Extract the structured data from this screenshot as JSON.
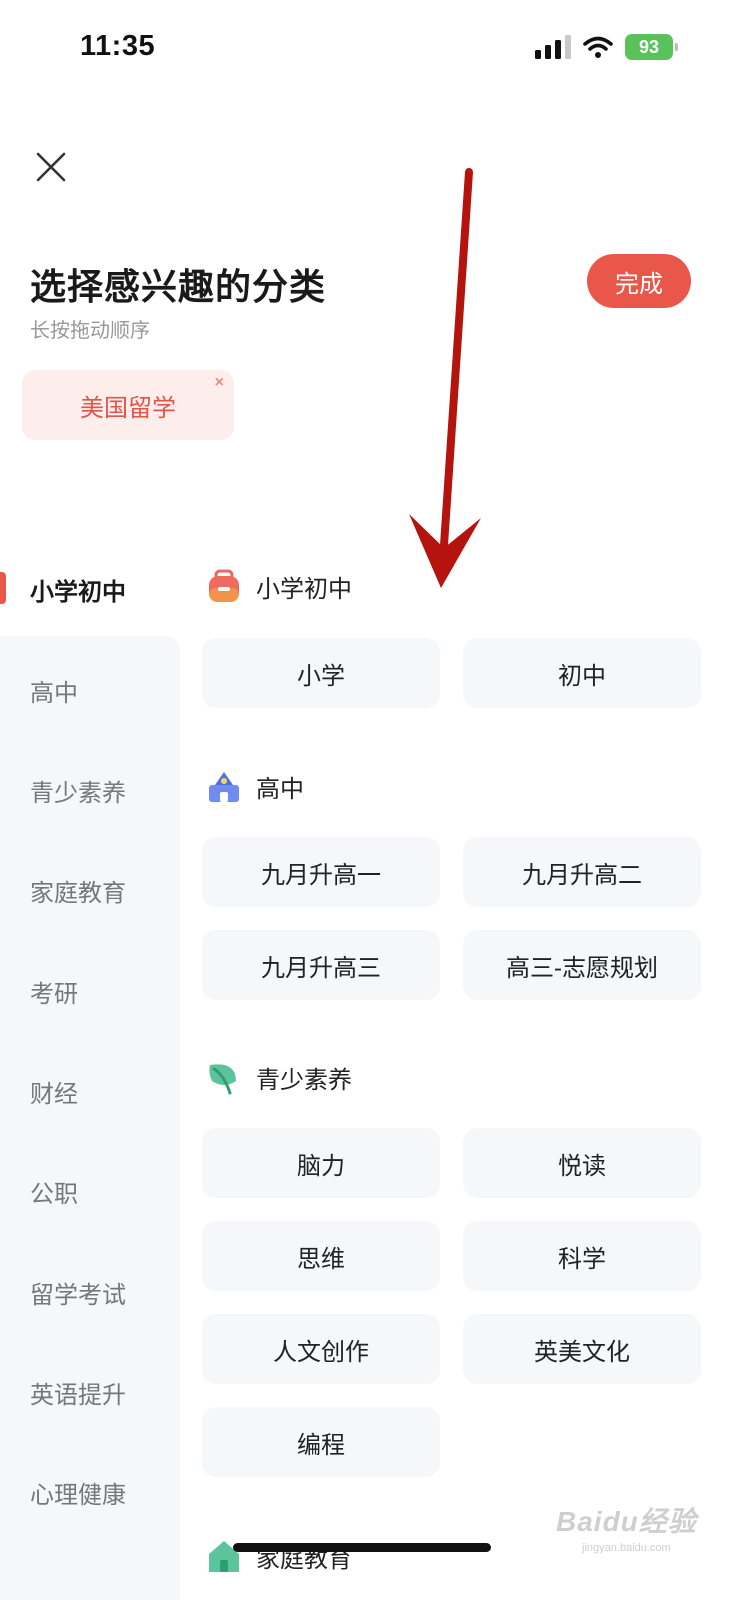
{
  "status_bar": {
    "time": "11:35",
    "battery": "93"
  },
  "header": {
    "title": "选择感兴趣的分类",
    "subtitle": "长按拖动顺序",
    "done_label": "完成"
  },
  "selected": [
    {
      "label": "美国留学",
      "remove": "×"
    }
  ],
  "nav": [
    {
      "label": "小学初中",
      "active": true
    },
    {
      "label": "高中"
    },
    {
      "label": "青少素养"
    },
    {
      "label": "家庭教育"
    },
    {
      "label": "考研"
    },
    {
      "label": "财经"
    },
    {
      "label": "公职"
    },
    {
      "label": "留学考试"
    },
    {
      "label": "英语提升"
    },
    {
      "label": "心理健康"
    }
  ],
  "sections": [
    {
      "title": "小学初中",
      "icon": "backpack-icon",
      "tags": [
        "小学",
        "初中"
      ]
    },
    {
      "title": "高中",
      "icon": "school-building-icon",
      "tags": [
        "九月升高一",
        "九月升高二",
        "九月升高三",
        "高三-志愿规划"
      ]
    },
    {
      "title": "青少素养",
      "icon": "leaf-icon",
      "tags": [
        "脑力",
        "悦读",
        "思维",
        "科学",
        "人文创作",
        "英美文化",
        "编程"
      ]
    },
    {
      "title": "家庭教育",
      "icon": "house-icon",
      "tags": []
    }
  ],
  "colors": {
    "accent": "#e9574a",
    "chip_bg": "#fdeeec",
    "tag_bg": "#f6f7f9",
    "annotation_arrow": "#b5130e"
  },
  "watermark": {
    "main": "Baidu经验",
    "sub": "jingyan.baidu.com"
  }
}
